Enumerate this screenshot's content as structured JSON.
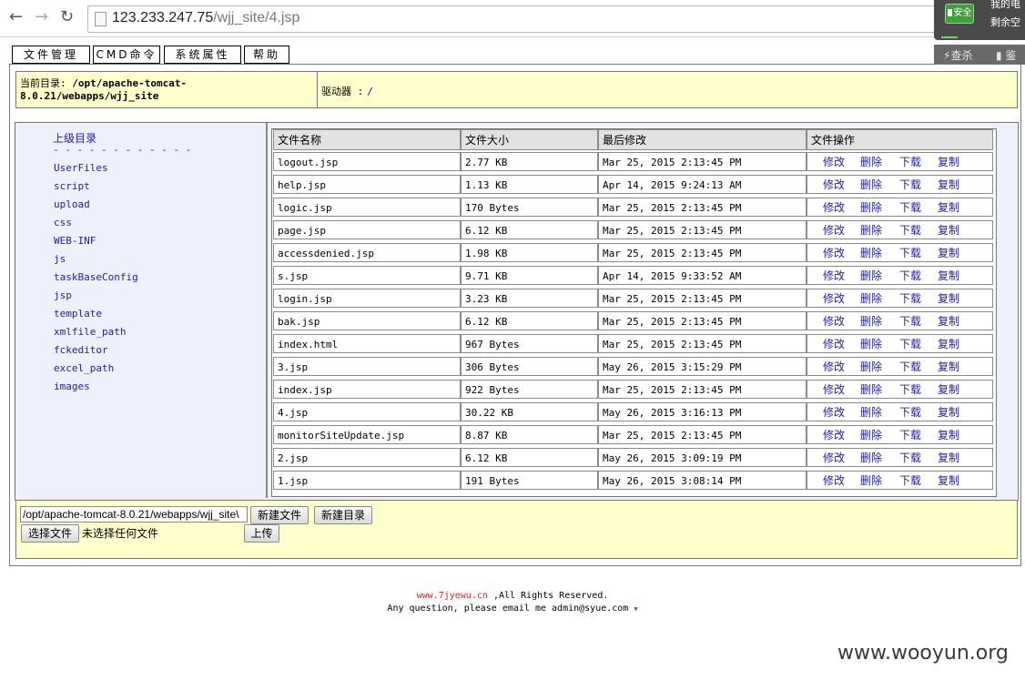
{
  "browser": {
    "back_icon": "←",
    "forward_icon": "→",
    "reload_icon": "↻",
    "url_host": "123.233.247.75",
    "url_path": "/wjj_site/4.jsp",
    "ext_safe": "安全",
    "ext_line1": "我的电",
    "ext_line2": "剩余空",
    "ext_btn1": "查杀",
    "ext_btn2": "鉴"
  },
  "menu": [
    "文件管理",
    "CMD命令",
    "系统属性",
    "帮助"
  ],
  "path": {
    "label": "当前目录:",
    "value": "/opt/apache-tomcat-8.0.21/webapps/wjj_site",
    "drive_label": "驱动器 :",
    "drive_value": "/"
  },
  "sidebar": {
    "up_label": "上级目录",
    "divider": "- - - - - - - - - - - -",
    "dirs": [
      "UserFiles",
      "script",
      "upload",
      "css",
      "WEB-INF",
      "js",
      "taskBaseConfig",
      "jsp",
      "template",
      "xmlfile_path",
      "fckeditor",
      "excel_path",
      "images"
    ]
  },
  "table": {
    "headers": [
      "文件名称",
      "文件大小",
      "最后修改",
      "文件操作"
    ],
    "ops": [
      "修改",
      "删除",
      "下载",
      "复制"
    ],
    "rows": [
      [
        "logout.jsp",
        "2.77 KB",
        "Mar 25, 2015 2:13:45 PM"
      ],
      [
        "help.jsp",
        "1.13 KB",
        "Apr 14, 2015 9:24:13 AM"
      ],
      [
        "logic.jsp",
        "170 Bytes",
        "Mar 25, 2015 2:13:45 PM"
      ],
      [
        "page.jsp",
        "6.12 KB",
        "Mar 25, 2015 2:13:45 PM"
      ],
      [
        "accessdenied.jsp",
        "1.98 KB",
        "Mar 25, 2015 2:13:45 PM"
      ],
      [
        "s.jsp",
        "9.71 KB",
        "Apr 14, 2015 9:33:52 AM"
      ],
      [
        "login.jsp",
        "3.23 KB",
        "Mar 25, 2015 2:13:45 PM"
      ],
      [
        "bak.jsp",
        "6.12 KB",
        "Mar 25, 2015 2:13:45 PM"
      ],
      [
        "index.html",
        "967 Bytes",
        "Mar 25, 2015 2:13:45 PM"
      ],
      [
        "3.jsp",
        "306 Bytes",
        "May 26, 2015 3:15:29 PM"
      ],
      [
        "index.jsp",
        "922 Bytes",
        "Mar 25, 2015 2:13:45 PM"
      ],
      [
        "4.jsp",
        "30.22 KB",
        "May 26, 2015 3:16:13 PM"
      ],
      [
        "monitorSiteUpdate.jsp",
        "8.87 KB",
        "Mar 25, 2015 2:13:45 PM"
      ],
      [
        "2.jsp",
        "6.12 KB",
        "May 26, 2015 3:09:19 PM"
      ],
      [
        "1.jsp",
        "191 Bytes",
        "May 26, 2015 3:08:14 PM"
      ]
    ]
  },
  "actions": {
    "path_value": "/opt/apache-tomcat-8.0.21/webapps/wjj_site\\",
    "new_file": "新建文件",
    "new_dir": "新建目录",
    "choose_file": "选择文件",
    "no_file": "未选择任何文件",
    "upload": "上传"
  },
  "footer": {
    "site": "www.7jyewu.cn",
    "rights": ",All Rights Reserved.",
    "question": "Any question, please email me admin@syue.com",
    "mark": "▼"
  },
  "watermark": "www.wooyun.org"
}
